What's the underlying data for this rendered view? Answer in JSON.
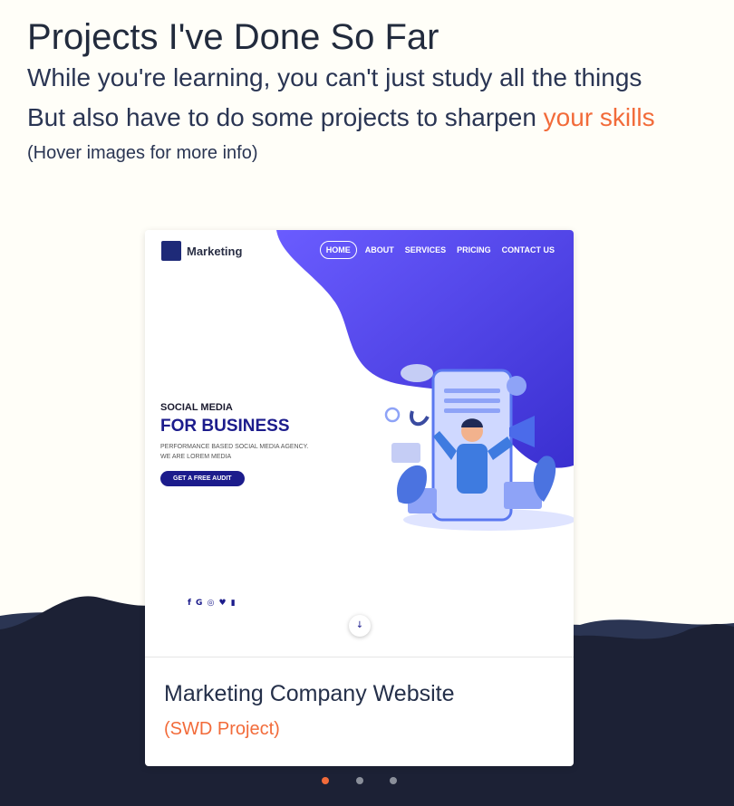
{
  "header": {
    "title": "Projects I've Done So Far",
    "line1": "While you're learning, you can't just study all the things",
    "line2_prefix": "But also have to do some projects to sharpen ",
    "line2_accent": "your skills",
    "hint": "(Hover images for more info)"
  },
  "project": {
    "title": "Marketing Company Website",
    "subtitle": "(SWD Project)",
    "preview": {
      "brand": "Marketing",
      "nav": [
        "HOME",
        "ABOUT",
        "SERVICES",
        "PRICING",
        "CONTACT US"
      ],
      "hero_small": "SOCIAL MEDIA",
      "hero_big": "FOR BUSINESS",
      "hero_desc_1": "PERFORMANCE BASED SOCIAL MEDIA AGENCY.",
      "hero_desc_2": "WE ARE LOREM MEDIA",
      "hero_button": "GET A FREE AUDIT",
      "socials": "f G ◎ ♥ ▮",
      "scroll_icon": "↓"
    }
  },
  "carousel": {
    "count": 3,
    "active_index": 0
  },
  "colors": {
    "accent": "#f26b3a",
    "wave_dark": "#1c2135",
    "wave_mid": "#2b3553",
    "background": "#fffef8"
  }
}
